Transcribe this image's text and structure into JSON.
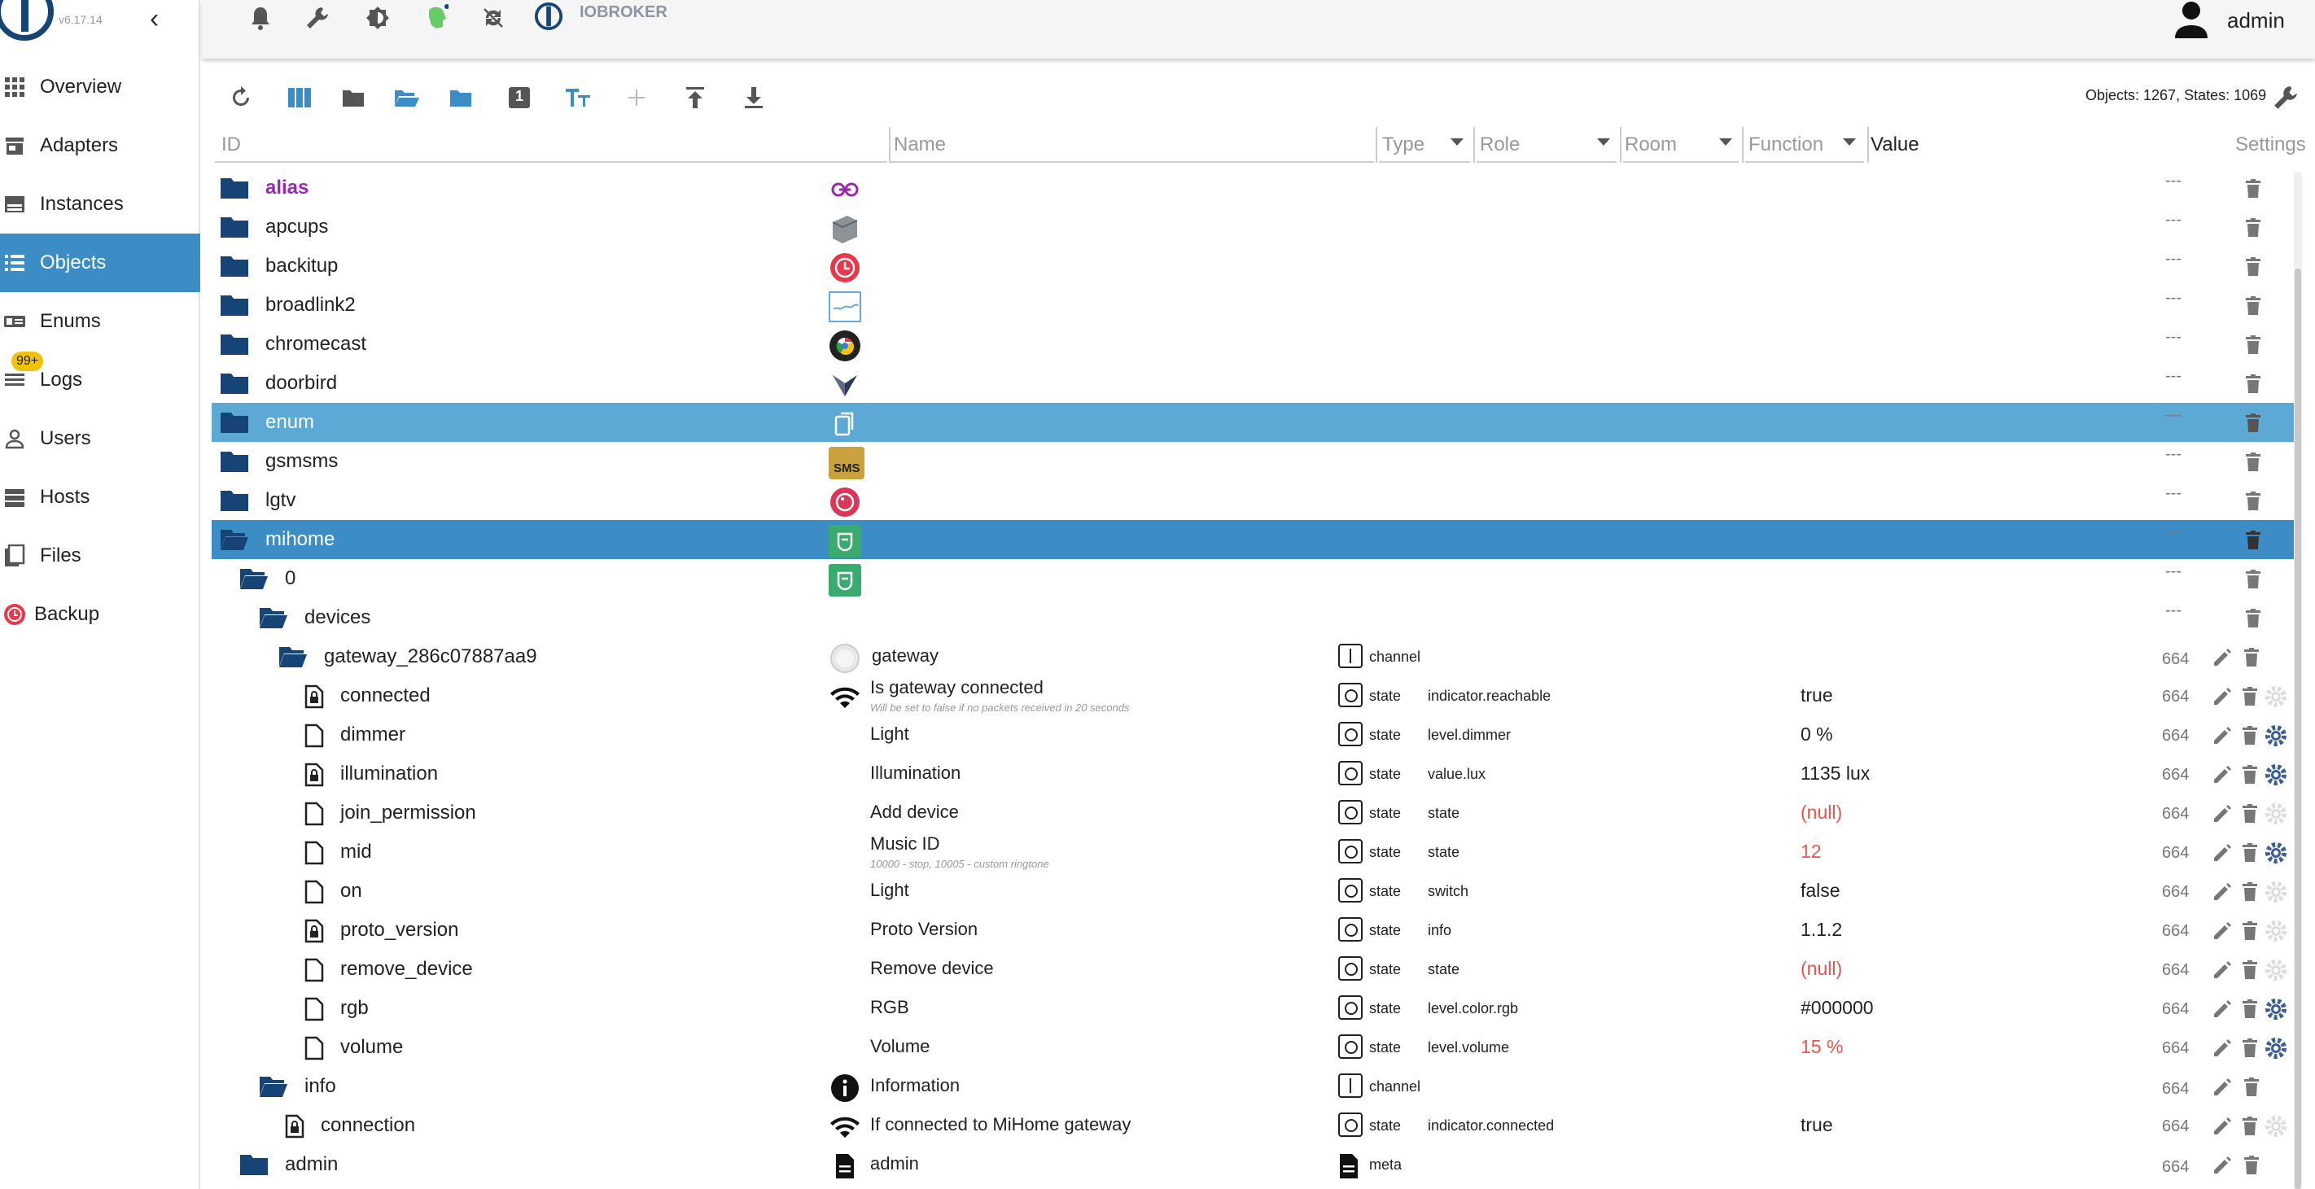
{
  "app": {
    "version": "v6.17.14",
    "brand": "IOBROKER",
    "user": "admin"
  },
  "sidebar": {
    "items": [
      {
        "label": "Overview",
        "icon": "grid-icon"
      },
      {
        "label": "Adapters",
        "icon": "store-icon"
      },
      {
        "label": "Instances",
        "icon": "instances-icon"
      },
      {
        "label": "Objects",
        "icon": "list-icon",
        "active": true
      },
      {
        "label": "Enums",
        "icon": "enums-icon"
      },
      {
        "label": "Logs",
        "icon": "logs-icon"
      },
      {
        "label": "Users",
        "icon": "user-icon"
      },
      {
        "label": "Hosts",
        "icon": "hosts-icon"
      },
      {
        "label": "Files",
        "icon": "files-icon"
      },
      {
        "label": "Backup",
        "icon": "backup-icon"
      }
    ],
    "logs_badge": "99+"
  },
  "toolbar": {
    "stats": "Objects: 1267, States: 1069",
    "level_button": "1"
  },
  "columns": {
    "id": "ID",
    "name": "Name",
    "type": "Type",
    "role": "Role",
    "room": "Room",
    "function": "Function",
    "value": "Value",
    "settings": "Settings"
  },
  "rows": [
    {
      "id": "alias",
      "name": "",
      "acl": "---"
    },
    {
      "id": "apcups",
      "name": "",
      "acl": "---"
    },
    {
      "id": "backitup",
      "name": "",
      "acl": "---"
    },
    {
      "id": "broadlink2",
      "name": "",
      "acl": "---"
    },
    {
      "id": "chromecast",
      "name": "",
      "acl": "---"
    },
    {
      "id": "doorbird",
      "name": "",
      "acl": "---"
    },
    {
      "id": "enum",
      "name": "",
      "acl": "---"
    },
    {
      "id": "gsmsms",
      "name": "",
      "acl": "---",
      "icon_text": "SMS"
    },
    {
      "id": "lgtv",
      "name": "",
      "acl": "---"
    },
    {
      "id": "mihome",
      "name": "",
      "acl": "---"
    },
    {
      "id": "0",
      "name": "",
      "acl": "---"
    },
    {
      "id": "devices",
      "name": "",
      "acl": "---"
    },
    {
      "id": "gateway_286c07887aa9",
      "name": "gateway",
      "type": "channel",
      "role": "",
      "value": "",
      "acl": "664"
    },
    {
      "id": "connected",
      "name": "Is gateway connected",
      "sub": "Will be set to false if no packets received in 20 seconds",
      "type": "state",
      "role": "indicator.reachable",
      "value": "true",
      "acl": "664"
    },
    {
      "id": "dimmer",
      "name": "Light",
      "type": "state",
      "role": "level.dimmer",
      "value": "0 %",
      "acl": "664"
    },
    {
      "id": "illumination",
      "name": "Illumination",
      "type": "state",
      "role": "value.lux",
      "value": "1135 lux",
      "acl": "664"
    },
    {
      "id": "join_permission",
      "name": "Add device",
      "type": "state",
      "role": "state",
      "value": "(null)",
      "acl": "664"
    },
    {
      "id": "mid",
      "name": "Music ID",
      "sub": "10000 - stop, 10005 - custom ringtone",
      "type": "state",
      "role": "state",
      "value": "12",
      "acl": "664"
    },
    {
      "id": "on",
      "name": "Light",
      "type": "state",
      "role": "switch",
      "value": "false",
      "acl": "664"
    },
    {
      "id": "proto_version",
      "name": "Proto Version",
      "type": "state",
      "role": "info",
      "value": "1.1.2",
      "acl": "664"
    },
    {
      "id": "remove_device",
      "name": "Remove device",
      "type": "state",
      "role": "state",
      "value": "(null)",
      "acl": "664"
    },
    {
      "id": "rgb",
      "name": "RGB",
      "type": "state",
      "role": "level.color.rgb",
      "value": "#000000",
      "acl": "664"
    },
    {
      "id": "volume",
      "name": "Volume",
      "type": "state",
      "role": "level.volume",
      "value": "15 %",
      "acl": "664"
    },
    {
      "id": "info",
      "name": "Information",
      "type": "channel",
      "role": "",
      "value": "",
      "acl": "664"
    },
    {
      "id": "connection",
      "name": "If connected to MiHome gateway",
      "type": "state",
      "role": "indicator.connected",
      "value": "true",
      "acl": "664"
    },
    {
      "id": "admin",
      "name": "admin",
      "type": "meta",
      "role": "",
      "value": "",
      "acl": "664"
    }
  ],
  "colors": {
    "accent": "#3c8dc6",
    "selected_light": "#5ca9d6",
    "folder": "#164477",
    "alias": "#9c27b0",
    "value_red": "#e8544f",
    "badge": "#f0c20b"
  }
}
